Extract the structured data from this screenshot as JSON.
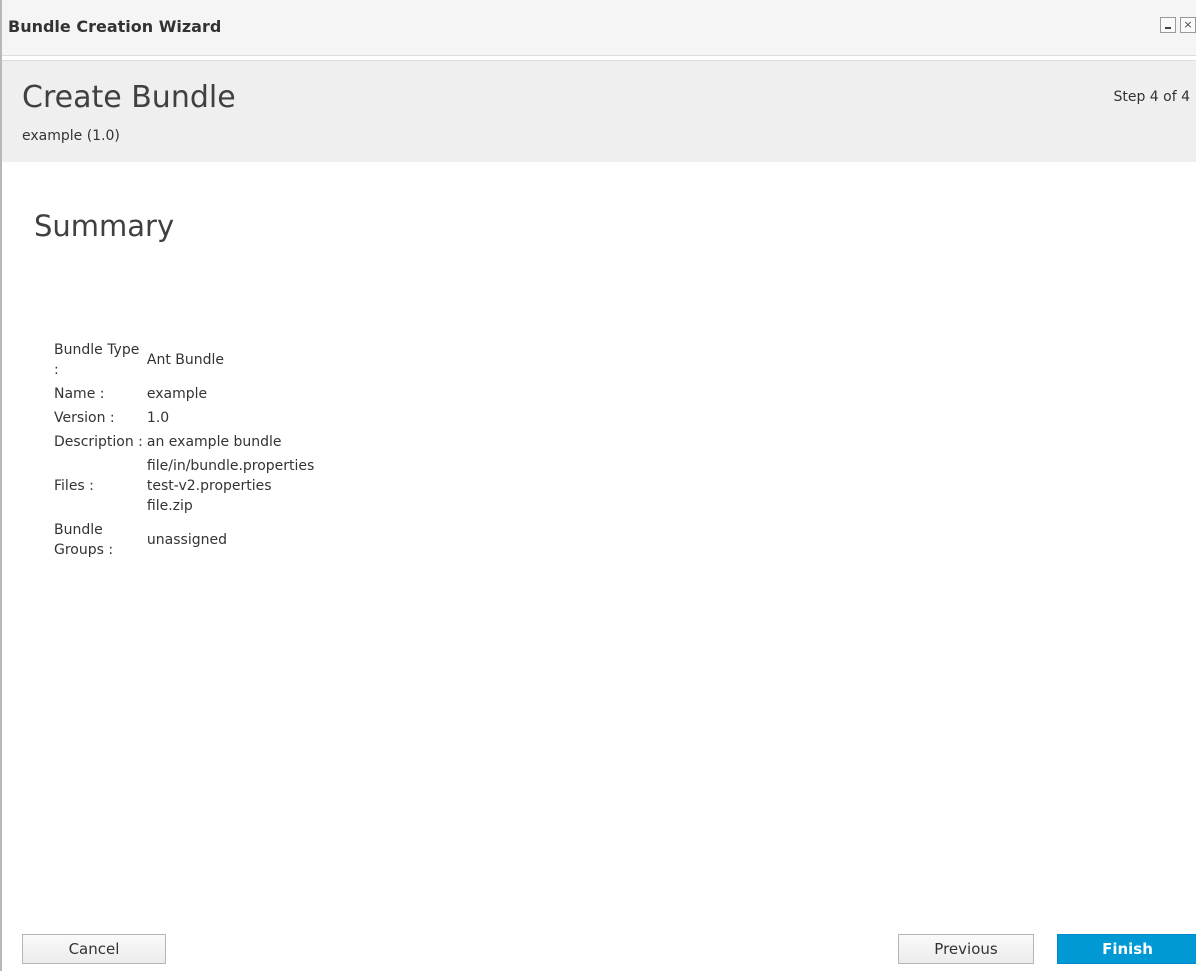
{
  "window": {
    "title": "Bundle Creation Wizard",
    "minimize_icon": "minimize-icon",
    "close_icon": "close-icon",
    "close_glyph": "×"
  },
  "header": {
    "title": "Create Bundle",
    "subtitle": "example (1.0)",
    "step": "Step 4 of 4"
  },
  "summary": {
    "title": "Summary",
    "rows": [
      {
        "label": "Bundle Type :",
        "values": [
          "Ant Bundle"
        ]
      },
      {
        "label": "Name :",
        "values": [
          "example"
        ]
      },
      {
        "label": "Version :",
        "values": [
          "1.0"
        ]
      },
      {
        "label": "Description :",
        "values": [
          "an example bundle"
        ]
      },
      {
        "label": "Files :",
        "values": [
          "file/in/bundle.properties",
          "test-v2.properties",
          "file.zip"
        ]
      },
      {
        "label": "Bundle Groups :",
        "values": [
          "unassigned"
        ]
      }
    ]
  },
  "footer": {
    "cancel_label": "Cancel",
    "previous_label": "Previous",
    "finish_label": "Finish"
  },
  "colors": {
    "primary_button": "#0099d3",
    "header_background": "#efefef"
  }
}
